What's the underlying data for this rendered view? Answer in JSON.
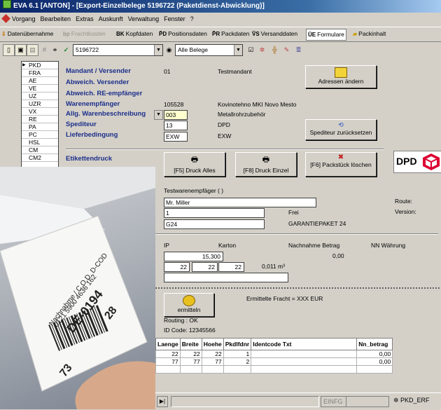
{
  "window": {
    "title": "EVA 6.1  [ANTON]  - [Export-Einzelbelege 5196722  (Paketdienst-Abwicklung)]"
  },
  "menu": [
    "Vorgang",
    "Bearbeiten",
    "Extras",
    "Auskunft",
    "Verwaltung",
    "Fenster",
    "?"
  ],
  "tabs": [
    {
      "icon": "import",
      "label": "Datenübernahme"
    },
    {
      "icon": "freight",
      "label": "Frachtkosten"
    },
    {
      "icon": "head",
      "label": "Kopfdaten"
    },
    {
      "icon": "positions",
      "label": "Positionsdaten"
    },
    {
      "icon": "pack",
      "label": "Packdaten"
    },
    {
      "icon": "ship",
      "label": "Versanddaten"
    },
    {
      "icon": "forms",
      "label": "Formulare"
    },
    {
      "icon": "content",
      "label": "Packinhalt"
    }
  ],
  "toolbar": {
    "beleg_number": "5196722",
    "filter_value": "Alle Belege",
    "icons": [
      "new-doc-icon",
      "save-icon",
      "print-preview-icon",
      "hash-icon",
      "binoculars-icon",
      "check-icon",
      "checkbox-icon",
      "tools-icon",
      "branch-icon",
      "pen-icon",
      "list-icon"
    ]
  },
  "list": {
    "items": [
      "PKD",
      "FRA",
      "AE",
      "VE",
      "UZ",
      "UZR",
      "VX",
      "RE",
      "PA",
      "PC",
      "HSL",
      "CM",
      "CM2"
    ],
    "active": "PKD"
  },
  "form": {
    "mandant_label": "Mandant / Versender",
    "mandant_nr": "01",
    "mandant_name": "Testmandant",
    "abw_versender_label": "Abweich. Versender",
    "abw_re_label": "Abweich. RE-empfänger",
    "waren_label": "Warenempfänger",
    "waren_nr": "105528",
    "waren_name": "Kovinotehno MKI Novo Mesto",
    "allg_label": "Allg. Warenbeschreibung",
    "allg_code": "003",
    "allg_text": "Metallrohrzubehör",
    "spediteur_label": "Spediteur",
    "spediteur_code": "13",
    "spediteur_name": "DPD",
    "liefer_label": "Lieferbedingung",
    "liefer_code": "EXW",
    "liefer_name": "EXW",
    "adressen_btn": "Adressen ändern",
    "spediteur_reset_btn": "Spediteur zurücksetzen",
    "etikett_label": "Etikettendruck",
    "druck_alles_btn": "[F5] Druck Alles",
    "druck_einzel_btn": "[F8] Druck Einzel",
    "packstueck_btn": "[F6] Packstück löschen",
    "dpd_logo": "DPD"
  },
  "details": {
    "test_label": "Testwarenempfäger ( )",
    "name": "Mr. Miller",
    "field1": "1",
    "frei_label": "Frei",
    "field2": "G24",
    "garantie_text": "GARANTIEPAKET 24",
    "route_label": "Route:",
    "version_label": "Version:",
    "ip_label": "IP",
    "karton_label": "Karton",
    "nachnahme_label": "Nachnahme Betrag",
    "nn_waehrung_label": "NN Währung",
    "weight": "15,300",
    "nachnahme_value": "0,00",
    "dim1": "22",
    "dim2": "22",
    "dim3": "22",
    "volume": "0,011 m³",
    "ermitteln_btn": "ermitteln",
    "fracht_text": "Ermittelte Fracht = XXX EUR",
    "routing_text": "Routing : OK",
    "id_code_text": "ID Code:  12345566"
  },
  "table": {
    "headers": [
      "Laenge",
      "Breite",
      "Hoehe",
      "Pkdlfdnr",
      "Identcode Txt",
      "Nn_betrag"
    ],
    "rows": [
      [
        "22",
        "22",
        "22",
        "1",
        "",
        "0,00"
      ],
      [
        "77",
        "77",
        "77",
        "2",
        "",
        "0,00"
      ]
    ]
  },
  "status": {
    "mode": "EINFG",
    "tag": "PKD_ERF"
  },
  "photo": {
    "label_lines": [
      "Nachnahme / C.O.D. D-COD",
      "0121 5900 4636 162",
      "DE-0194",
      "73",
      "28"
    ]
  }
}
